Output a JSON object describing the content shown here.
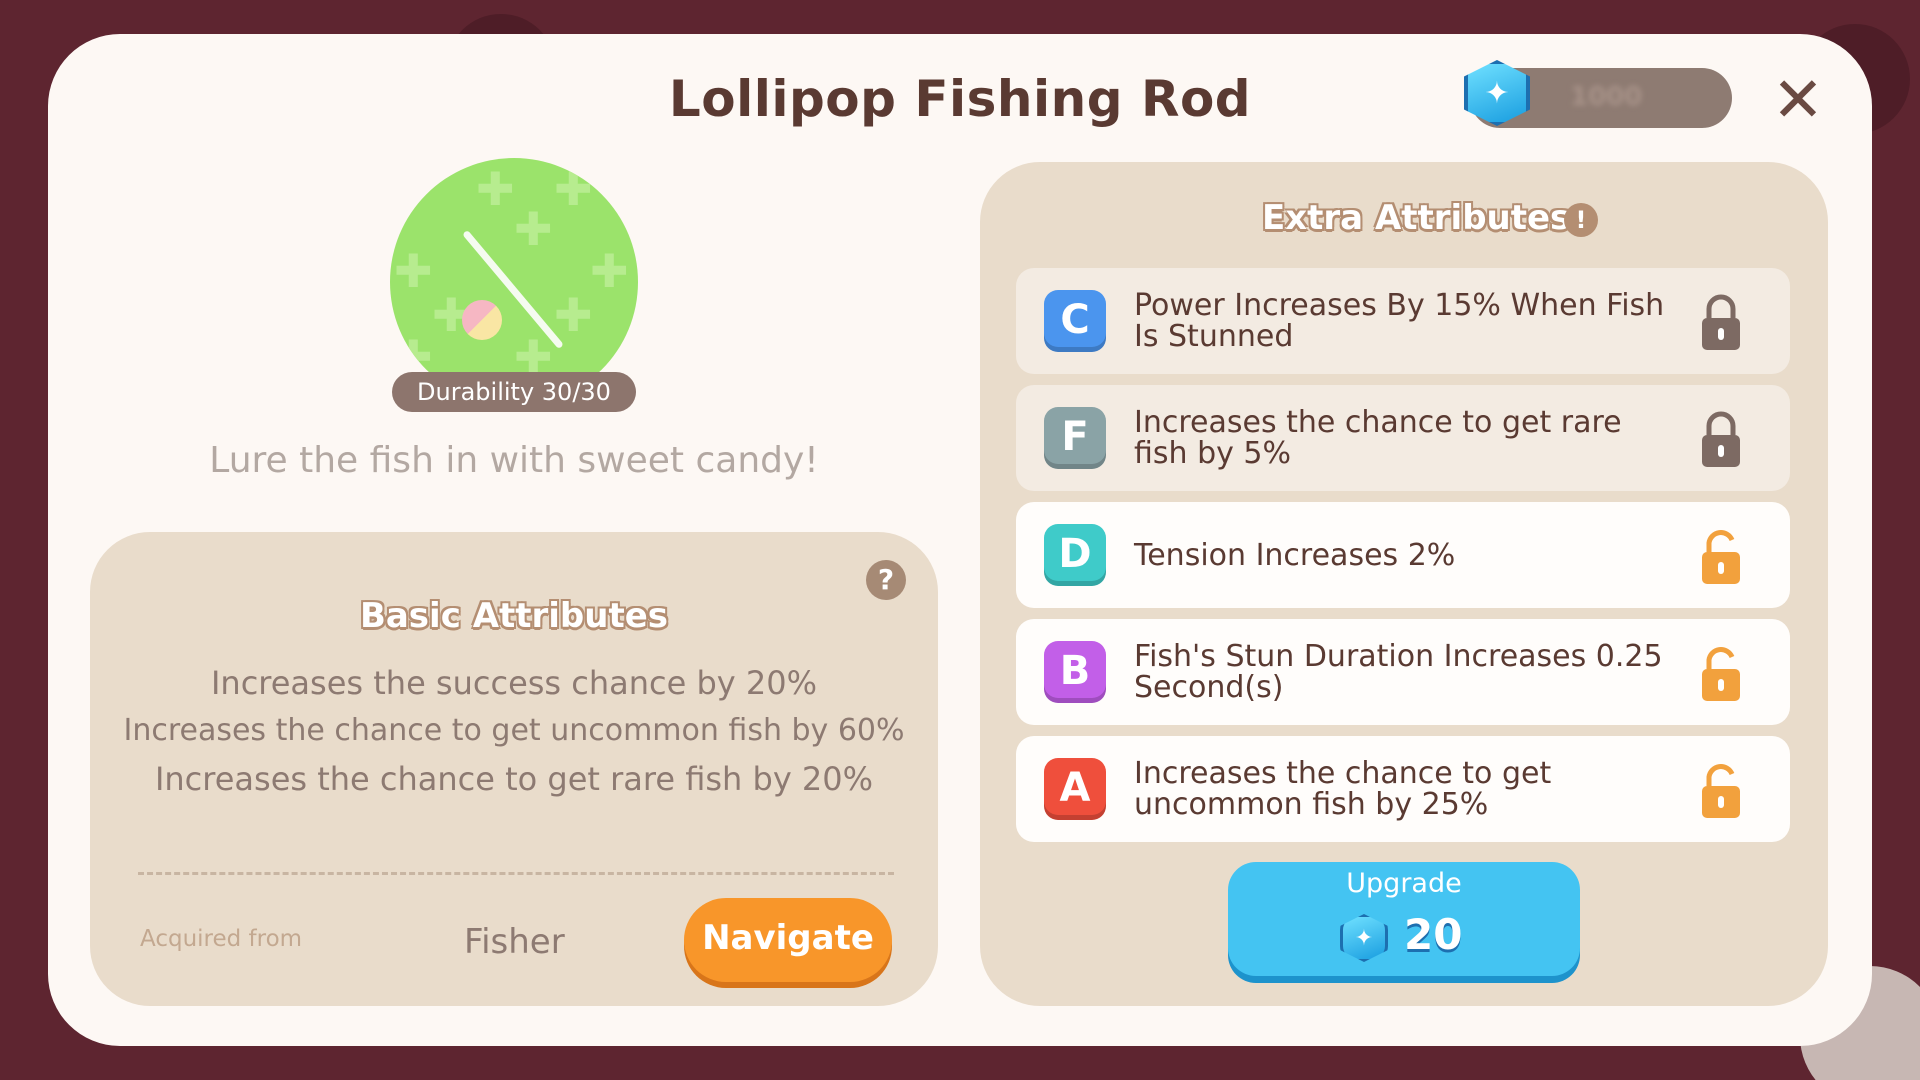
{
  "modal": {
    "title": "Lollipop Fishing Rod",
    "close_icon": "close-icon",
    "currency": {
      "icon": "gem-icon",
      "value": "1000"
    }
  },
  "item": {
    "icon": "lollipop-fishing-rod-icon",
    "durability": "Durability 30/30",
    "description": "Lure the fish in with sweet candy!"
  },
  "basic": {
    "title": "Basic Attributes",
    "help_icon": "question-icon",
    "lines": [
      "Increases the success chance by 20%",
      "Increases the chance to get uncommon fish by 60%",
      "Increases the chance to get rare fish by 20%"
    ],
    "acquired_label": "Acquired from",
    "acquired_value": "Fisher",
    "navigate_label": "Navigate"
  },
  "extra": {
    "title": "Extra Attributes",
    "info_icon": "exclamation-icon",
    "rows": [
      {
        "grade": "C",
        "color": "#4b95ee",
        "text": "Power Increases By 15% When Fish Is Stunned",
        "locked": true
      },
      {
        "grade": "F",
        "color": "#8aa3a6",
        "text": "Increases the chance to get rare fish by 5%",
        "locked": true
      },
      {
        "grade": "D",
        "color": "#3fcbc9",
        "text": "Tension Increases 2%",
        "locked": false
      },
      {
        "grade": "B",
        "color": "#c25fe8",
        "text": "Fish's Stun Duration Increases 0.25 Second(s)",
        "locked": false
      },
      {
        "grade": "A",
        "color": "#ef4f3c",
        "text": "Increases the chance to get uncommon fish by 25%",
        "locked": false
      }
    ],
    "upgrade_label": "Upgrade",
    "upgrade_cost": "20"
  },
  "colors": {
    "background": "#5e2530",
    "panel": "#e9dccb",
    "upgrade": "#44c4f2",
    "navigate": "#f8962a",
    "lock_locked": "#7d6a63",
    "lock_unlocked": "#f2a13d"
  }
}
